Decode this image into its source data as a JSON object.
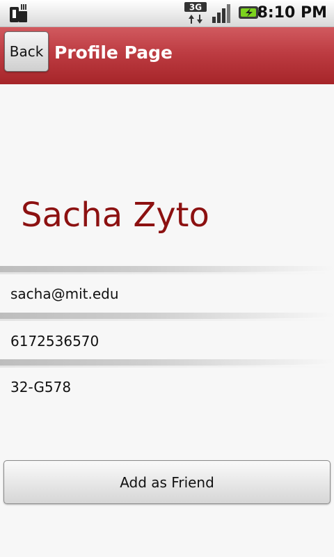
{
  "status_bar": {
    "time": "8:10 PM",
    "network_label": "3G",
    "icons": [
      "sd-card-icon",
      "3g-network-icon",
      "signal-strength-icon",
      "battery-charging-icon"
    ]
  },
  "title_bar": {
    "back_label": "Back",
    "title": "Profile Page",
    "color": "#b8363c"
  },
  "profile": {
    "name": "Sacha Zyto",
    "name_color": "#8c1111",
    "email": "sacha@mit.edu",
    "phone": "6172536570",
    "office": "32-G578"
  },
  "actions": {
    "add_friend_label": "Add as Friend"
  }
}
